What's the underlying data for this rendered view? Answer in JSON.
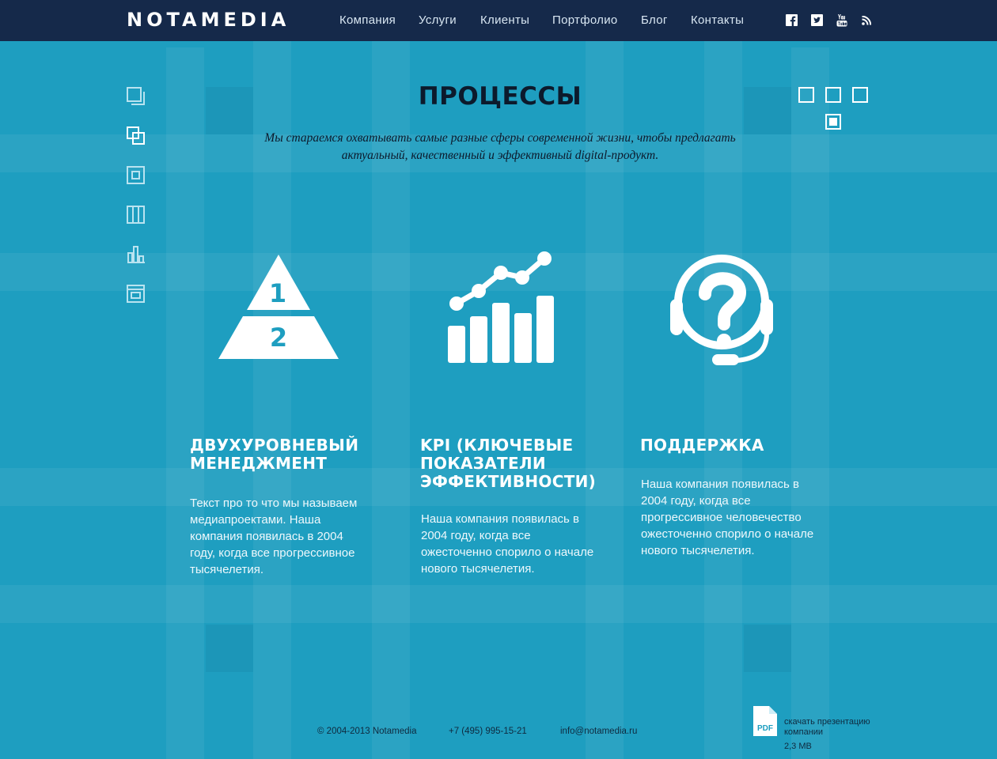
{
  "brand": {
    "logo": "NOTAMEDIA"
  },
  "nav": {
    "items": [
      {
        "label": "Компания"
      },
      {
        "label": "Услуги"
      },
      {
        "label": "Клиенты"
      },
      {
        "label": "Портфолио"
      },
      {
        "label": "Блог"
      },
      {
        "label": "Контакты"
      }
    ]
  },
  "social": [
    "facebook-icon",
    "twitter-icon",
    "youtube-icon",
    "rss-icon"
  ],
  "sidebar": {
    "icons": [
      "layers-icon",
      "overlap-icon",
      "frame-icon",
      "columns-icon",
      "bar-chart-icon",
      "window-icon"
    ]
  },
  "page": {
    "title": "ПРОЦЕССЫ",
    "subtitle": "Мы стараемся охватывать самые разные сферы современной жизни, чтобы предлагать актуальный, качественный и эффективный digital-продукт."
  },
  "slider": {
    "count": 4,
    "active_index": 3
  },
  "columns": [
    {
      "icon": "pyramid-icon",
      "pyramid_labels": [
        "1",
        "2"
      ],
      "title": "Двухуровневый менеджмент",
      "text": "Текст про то что мы называем медиапроектами. Наша компания появилась в 2004 году, когда все прогрессивное тысячелетия."
    },
    {
      "icon": "kpi-chart-icon",
      "title": "KPI (ключевые показатели эффективности)",
      "text": "Наша компания появилась в 2004 году, когда все ожесточенно спорило о начале нового тысячелетия."
    },
    {
      "icon": "support-headset-icon",
      "title": "Поддержка",
      "text": "Наша компания появилась в 2004 году, когда все прогрессивное человечество ожесточенно спорило о начале нового тысячелетия."
    }
  ],
  "footer": {
    "copyright": "© 2004-2013 Notamedia",
    "phone": "+7 (495) 995-15-21",
    "email": "info@notamedia.ru",
    "pdf_badge": "PDF",
    "download_label": "скачать презентацию компании",
    "download_size": "2,3 МВ"
  },
  "colors": {
    "header_bg": "#15294a",
    "page_bg": "#1e9ec0",
    "text_dark": "#0c1a2c"
  }
}
